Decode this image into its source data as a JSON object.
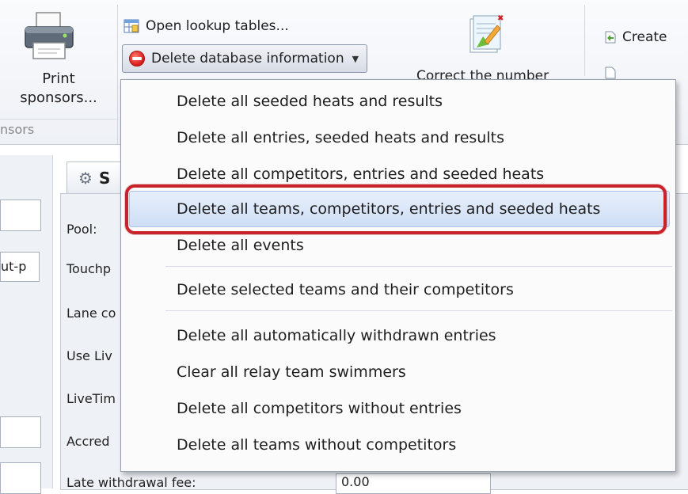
{
  "ribbon": {
    "print_label_line1": "Print",
    "print_label_line2": "sponsors...",
    "group_label": "nsors",
    "open_lookup_tables": "Open lookup tables...",
    "delete_database_info": "Delete database information",
    "correct_number_partial": "Correct the number",
    "create_partial": "Create"
  },
  "form": {
    "tab_label": "S",
    "left_field_value": "ut-p",
    "labels": [
      "Pool:",
      "Touchp",
      "Lane co",
      "Use Liv",
      "LiveTim",
      "Accred",
      "Late withdrawal fee:"
    ],
    "late_fee_value": "0.00"
  },
  "menu": {
    "items": [
      "Delete all seeded heats and results",
      "Delete all entries, seeded heats and results",
      "Delete all competitors, entries and seeded heats",
      "Delete all teams, competitors, entries and seeded heats",
      "Delete all events",
      "Delete selected teams and their competitors",
      "Delete all automatically withdrawn entries",
      "Clear all relay team swimmers",
      "Delete all competitors without entries",
      "Delete all teams without competitors"
    ],
    "highlighted_index": 3
  },
  "colors": {
    "highlight_outline": "#c8222b",
    "menu_highlight": "#d8e6f8",
    "delete_icon": "#d8191a"
  }
}
